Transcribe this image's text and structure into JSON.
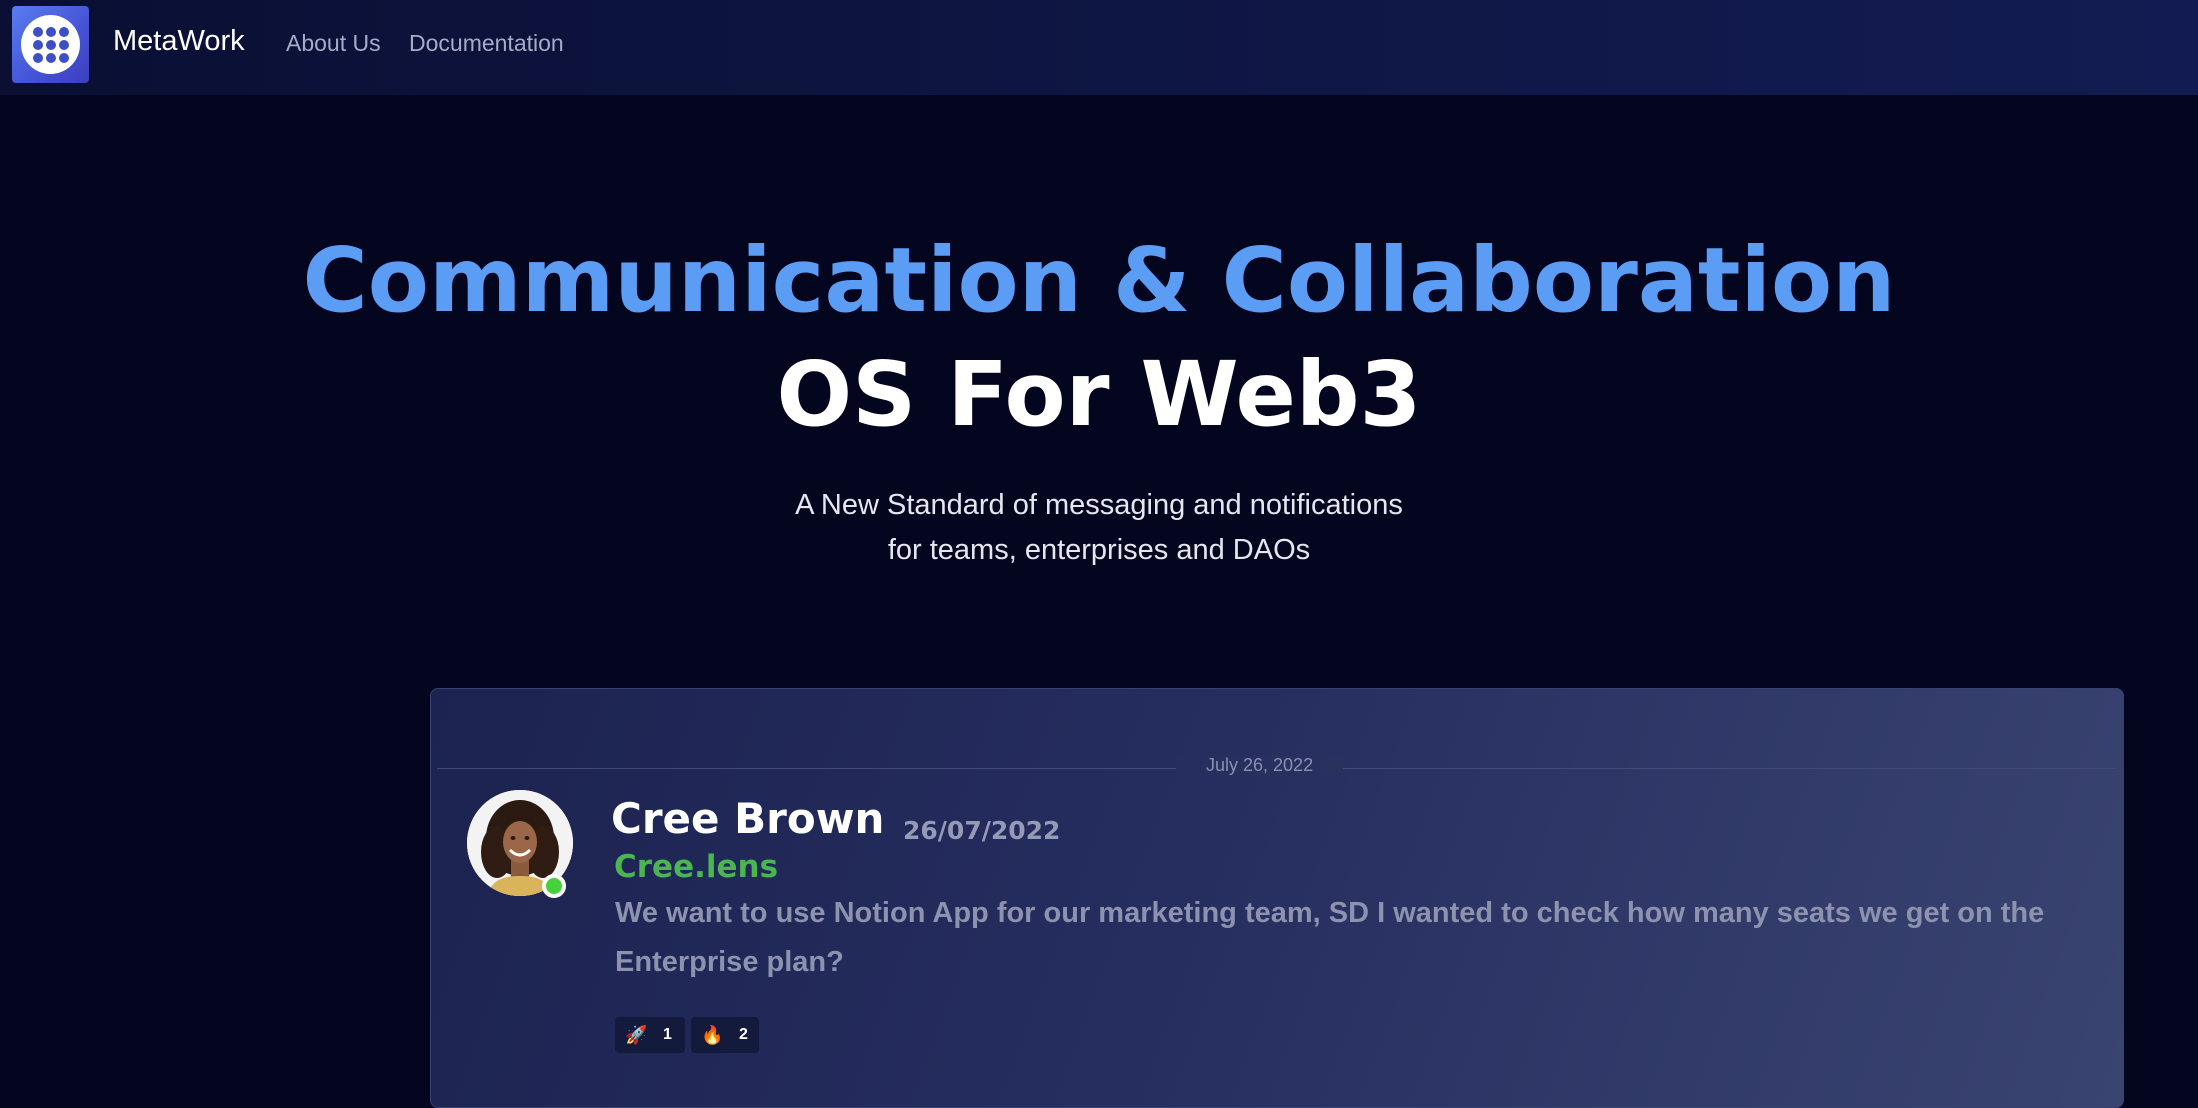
{
  "nav": {
    "brand": "MetaWork",
    "links": [
      "About Us",
      "Documentation"
    ]
  },
  "hero": {
    "title_line1": "Communication & Collaboration",
    "title_line2": "OS For Web3",
    "subtitle_line1": "A New Standard of messaging and notifications",
    "subtitle_line2": "for teams, enterprises and DAOs"
  },
  "chat": {
    "date_divider": "July 26, 2022",
    "message": {
      "author": "Cree Brown",
      "date": "26/07/2022",
      "handle": "Cree.lens",
      "text": "We want to use Notion App for our marketing team, SD I wanted to check how many seats we get on the Enterprise plan?",
      "reactions": [
        {
          "icon": "rocket-icon",
          "glyph": "🚀",
          "count": "1"
        },
        {
          "icon": "fire-icon",
          "glyph": "🔥",
          "count": "2"
        }
      ]
    }
  },
  "colors": {
    "accent_blue": "#5b9cf5",
    "status_online": "#45d13a",
    "handle_green": "#49b650"
  }
}
